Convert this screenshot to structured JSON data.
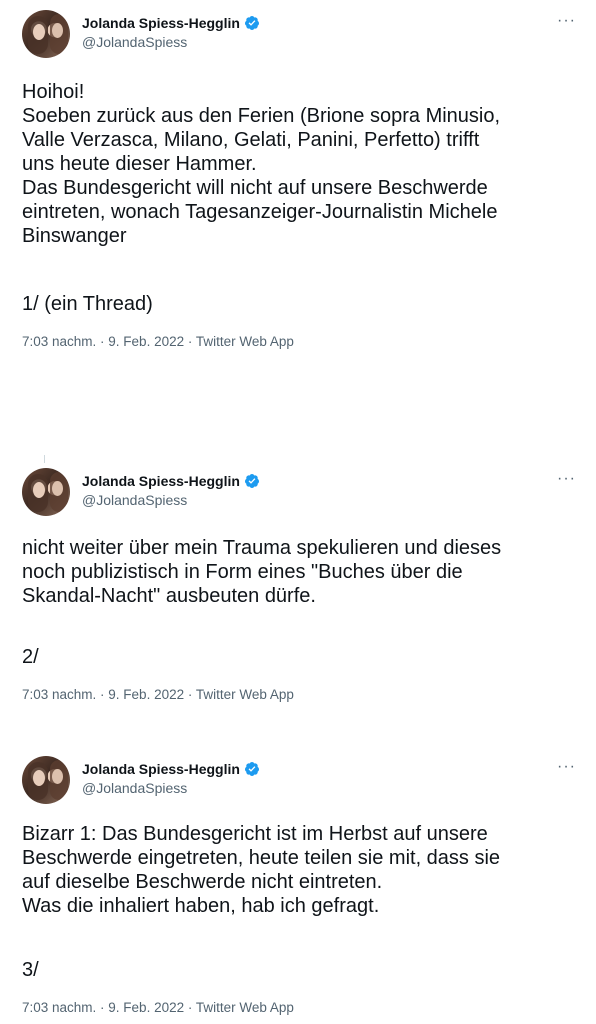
{
  "tweets": [
    {
      "author_name": "Jolanda Spiess-Hegglin",
      "handle": "@JolandaSpiess",
      "text": "Hoihoi!\nSoeben zurück aus den Ferien (Brione sopra Minusio,\nValle Verzasca, Milano, Gelati, Panini, Perfetto) trifft\nuns heute dieser Hammer.\nDas Bundesgericht will nicht auf unsere Beschwerde\neintreten, wonach Tagesanzeiger-Journalistin Michele\nBinswanger",
      "thread_marker": "1/ (ein Thread)",
      "time": "7:03 nachm.",
      "date": "9. Feb. 2022",
      "app": "Twitter Web App"
    },
    {
      "author_name": "Jolanda Spiess-Hegglin",
      "handle": "@JolandaSpiess",
      "text": "nicht weiter über mein Trauma spekulieren und dieses\nnoch publizistisch in Form eines \"Buches über die\nSkandal-Nacht\" ausbeuten dürfe.",
      "thread_marker": "2/",
      "time": "7:03 nachm.",
      "date": "9. Feb. 2022",
      "app": "Twitter Web App"
    },
    {
      "author_name": "Jolanda Spiess-Hegglin",
      "handle": "@JolandaSpiess",
      "text": "Bizarr 1: Das Bundesgericht ist im Herbst auf unsere\nBeschwerde eingetreten, heute teilen sie mit, dass sie\nauf dieselbe Beschwerde nicht eintreten.\nWas die inhaliert haben, hab ich gefragt.",
      "thread_marker": "3/",
      "time": "7:03 nachm.",
      "date": "9. Feb. 2022",
      "app": "Twitter Web App"
    }
  ],
  "ui": {
    "more_label": "···",
    "meta_separator": " · ",
    "verified_color": "#1d9bf0"
  }
}
